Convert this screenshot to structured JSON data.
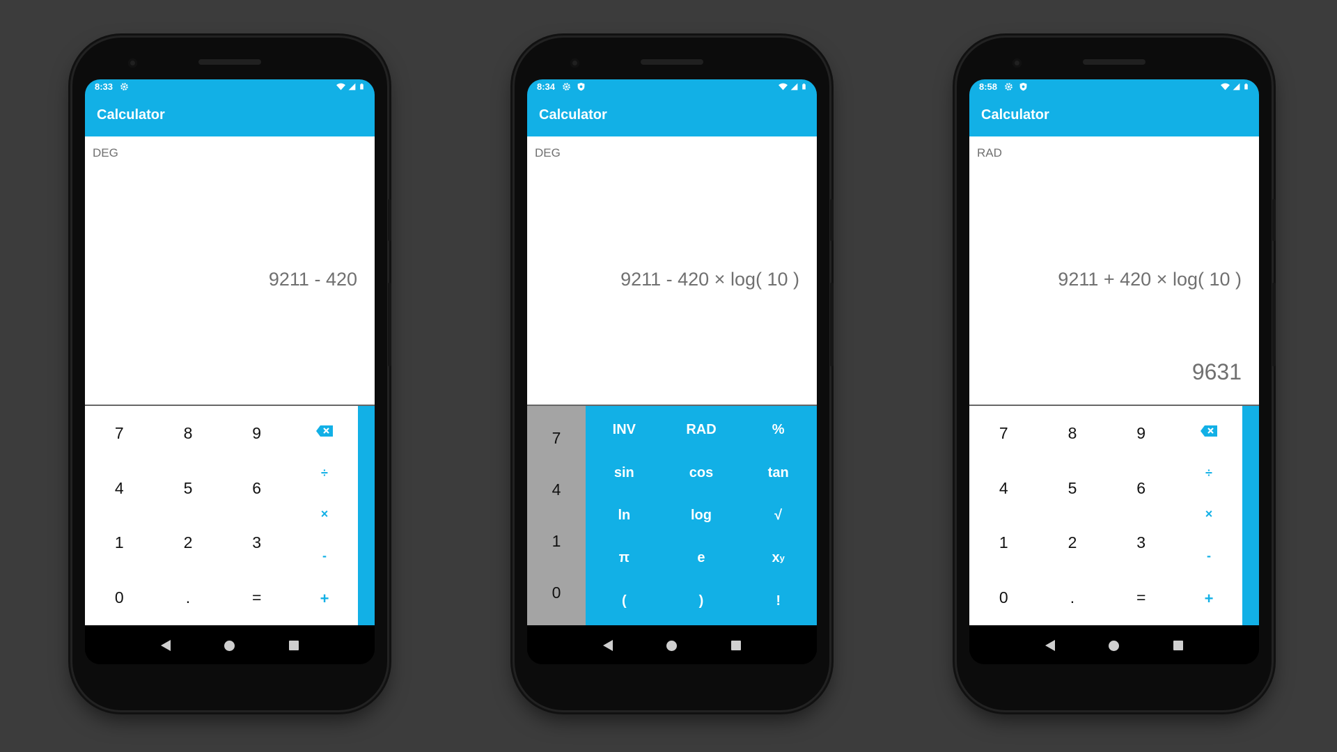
{
  "colors": {
    "accent": "#12b0e6",
    "background": "#3c3c3c",
    "display_text": "#707070"
  },
  "phones": [
    {
      "status_time": "8:33",
      "app_title": "Calculator",
      "angle_mode": "DEG",
      "expression": "9211 - 420",
      "result": "",
      "numpad": [
        "7",
        "8",
        "9",
        "4",
        "5",
        "6",
        "1",
        "2",
        "3",
        "0",
        ".",
        "="
      ],
      "operators": [
        "÷",
        "×",
        "-",
        "+"
      ]
    },
    {
      "status_time": "8:34",
      "app_title": "Calculator",
      "angle_mode": "DEG",
      "expression": "9211 - 420 × log( 10 )",
      "result": "",
      "number_column": [
        "7",
        "4",
        "1",
        "0"
      ],
      "scientific": [
        "INV",
        "RAD",
        "%",
        "sin",
        "cos",
        "tan",
        "ln",
        "log",
        "√",
        "π",
        "e",
        "x",
        "(",
        ")",
        "!"
      ],
      "power_superscript": "y"
    },
    {
      "status_time": "8:58",
      "app_title": "Calculator",
      "angle_mode": "RAD",
      "expression": "9211 + 420 × log( 10 )",
      "result": "9631",
      "numpad": [
        "7",
        "8",
        "9",
        "4",
        "5",
        "6",
        "1",
        "2",
        "3",
        "0",
        ".",
        "="
      ],
      "operators": [
        "÷",
        "×",
        "-",
        "+"
      ]
    }
  ]
}
